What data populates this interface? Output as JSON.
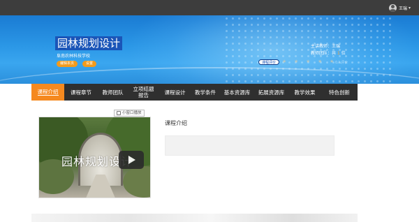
{
  "topbar": {
    "username": "王瑞",
    "avatar_icon": "user-avatar-icon",
    "menu_icon": "chevron-down-icon"
  },
  "banner": {
    "title": "园林规划设计",
    "school": "阜南农林科技学校",
    "edit_button": "编辑本页",
    "settings_button": "设置",
    "teacher_label": "主讲教师：王瑞",
    "team_label": "教师团队：共",
    "team_count": "1",
    "team_unit": "位",
    "evaluate_button": "课程评价",
    "eval_count": "0人评价",
    "rating": 0,
    "rating_max": 5,
    "accent_color": "#f29b1d",
    "brand_color": "#1a55b8"
  },
  "nav": {
    "items": [
      {
        "label": "课程介绍",
        "active": true
      },
      {
        "label": "课程章节"
      },
      {
        "label": "教师团队"
      },
      {
        "label": "立项结题报告"
      },
      {
        "label": "课程设计"
      },
      {
        "label": "教学条件"
      },
      {
        "label": "基本资源库"
      },
      {
        "label": "拓展资源库"
      },
      {
        "label": "教学效果"
      },
      {
        "label": "特色创新"
      }
    ],
    "active_color": "#f5891f"
  },
  "video": {
    "mini_window_label": "小窗口播放",
    "overlay_text": "园林规划设计",
    "play_icon": "play-icon"
  },
  "intro": {
    "title": "课程介绍",
    "content": ""
  }
}
